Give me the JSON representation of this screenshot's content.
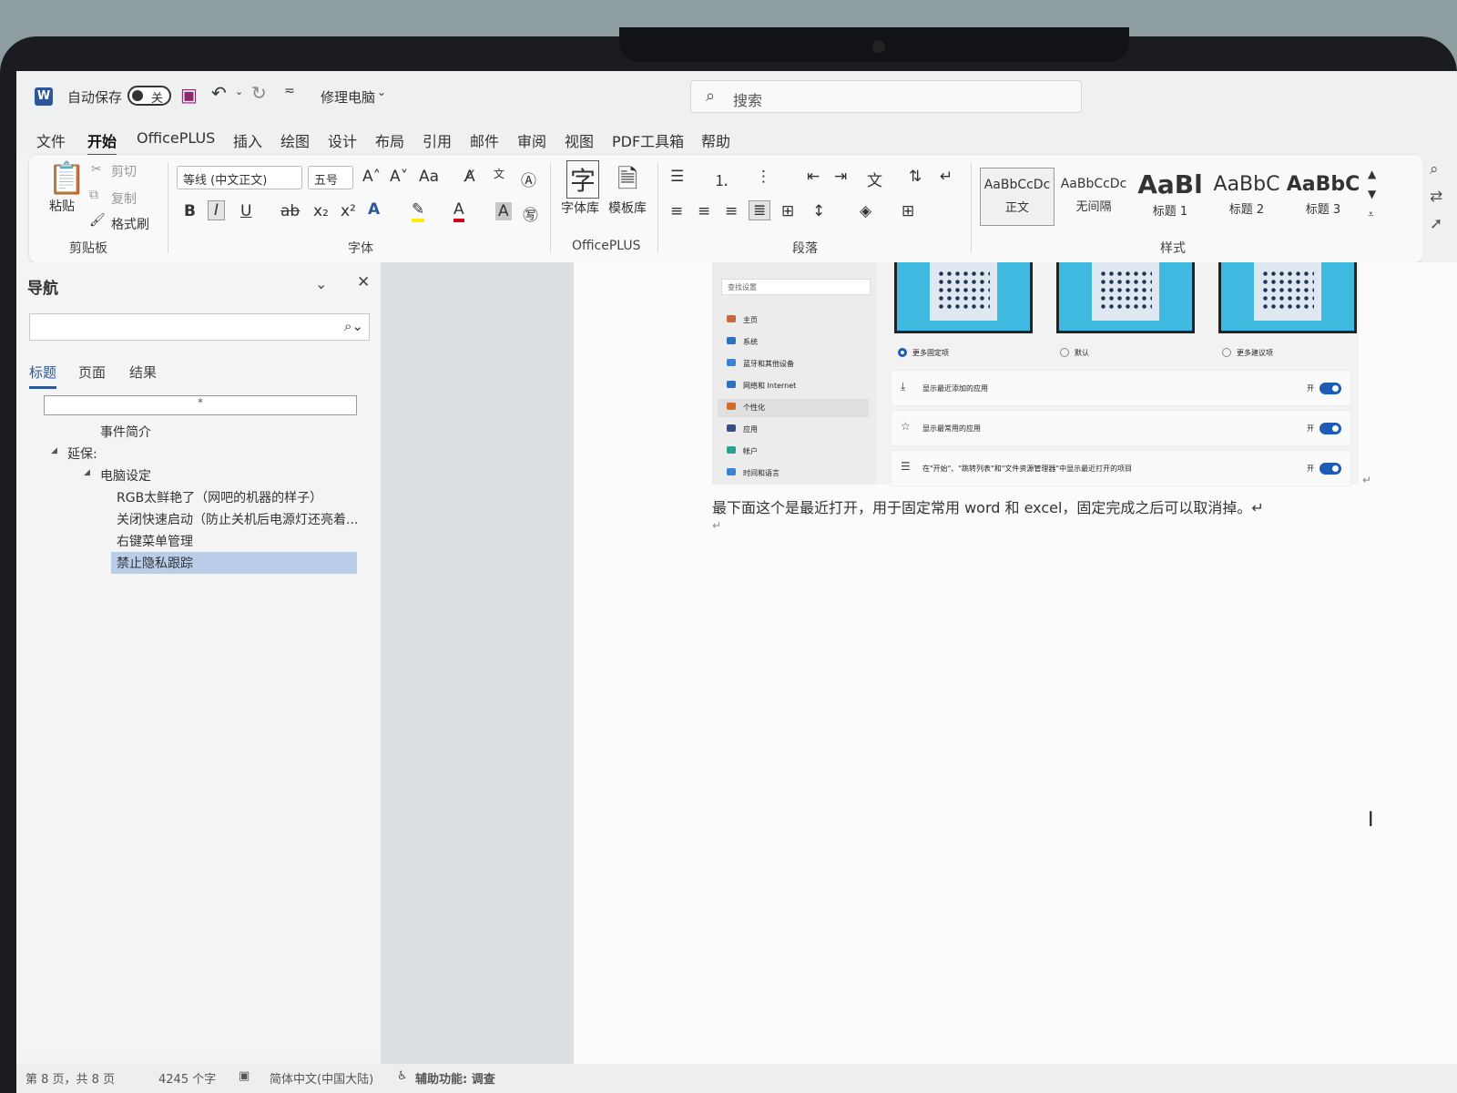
{
  "titlebar": {
    "autosave_label": "自动保存",
    "autosave_state": "关",
    "doc_title": "修理电脑",
    "search_placeholder": "搜索"
  },
  "menu": {
    "tabs": [
      "文件",
      "开始",
      "OfficePLUS",
      "插入",
      "绘图",
      "设计",
      "布局",
      "引用",
      "邮件",
      "审阅",
      "视图",
      "PDF工具箱",
      "帮助"
    ],
    "active": "开始"
  },
  "ribbon": {
    "clipboard": {
      "paste": "粘贴",
      "cut": "剪切",
      "copy": "复制",
      "format_painter": "格式刷",
      "group": "剪贴板"
    },
    "font": {
      "family": "等线 (中文正文)",
      "size": "五号",
      "group": "字体"
    },
    "officeplus": {
      "fonts": "字体库",
      "templates": "模板库",
      "group": "OfficePLUS"
    },
    "paragraph": {
      "group": "段落"
    },
    "styles": {
      "group": "样式",
      "items": [
        {
          "sample": "AaBbCcDc",
          "name": "正文",
          "selected": true
        },
        {
          "sample": "AaBbCcDc",
          "name": "无间隔"
        },
        {
          "sample": "AaBl",
          "name": "标题 1"
        },
        {
          "sample": "AaBbC",
          "name": "标题 2"
        },
        {
          "sample": "AaBbC",
          "name": "标题 3"
        }
      ]
    }
  },
  "nav": {
    "title": "导航",
    "tabs": [
      "标题",
      "页面",
      "结果"
    ],
    "active_tab": "标题",
    "search_marker": "*",
    "tree": [
      {
        "label": "事件简介",
        "level": 1
      },
      {
        "label": "延保:",
        "level": 0
      },
      {
        "label": "电脑设定",
        "level": 1
      },
      {
        "label": "RGB太鲜艳了（网吧的机器的样子）",
        "level": 2
      },
      {
        "label": "关闭快速启动（防止关机后电源灯还亮着...",
        "level": 2
      },
      {
        "label": "右键菜单管理",
        "level": 2
      },
      {
        "label": "禁止隐私跟踪",
        "level": 2,
        "selected": true
      }
    ]
  },
  "embedded_settings": {
    "search_placeholder": "查找设置",
    "nav_items": [
      "主页",
      "系统",
      "蓝牙和其他设备",
      "网络和 Internet",
      "个性化",
      "应用",
      "帐户",
      "时间和语言"
    ],
    "layout_options": [
      "更多固定项",
      "默认",
      "更多建议项"
    ],
    "toggles": [
      {
        "label": "显示最近添加的应用",
        "state": "开"
      },
      {
        "label": "显示最常用的应用",
        "state": "开"
      },
      {
        "label": "在\"开始\"、\"跳转列表\"和\"文件资源管理器\"中显示最近打开的项目",
        "state": "开"
      }
    ]
  },
  "document": {
    "paragraph": "最下面这个是最近打开，用于固定常用 word 和 excel，固定完成之后可以取消掉。↵",
    "empty_mark": "↵"
  },
  "status": {
    "page": "第 8 页，共 8 页",
    "words": "4245 个字",
    "language": "简体中文(中国大陆)",
    "accessibility": "辅助功能: 调查"
  },
  "colors": {
    "accent": "#2b579a",
    "toggle_on": "#1e5bb5",
    "thumb": "#3fb9e0"
  }
}
